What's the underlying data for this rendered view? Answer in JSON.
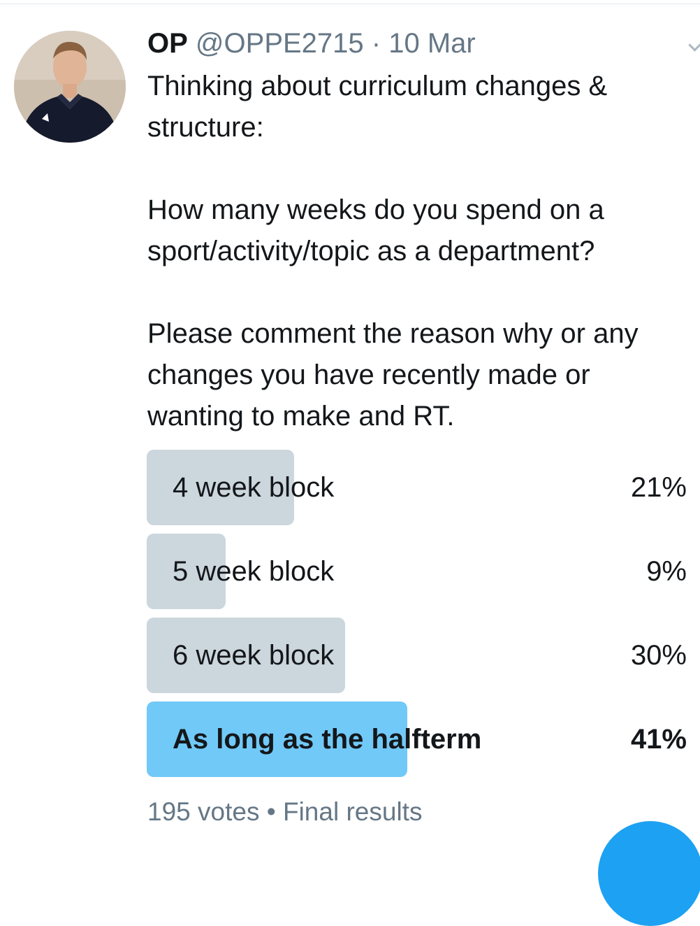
{
  "tweet": {
    "author_name": "OP",
    "handle": "@OPPE2715",
    "separator": "·",
    "date": "10 Mar",
    "text": "Thinking about curriculum changes &\nstructure:\n\nHow many weeks do you spend on a\nsport/activity/topic as a department?\n\nPlease comment the reason why or any\nchanges you have recently made or\nwanting to make and RT."
  },
  "poll": {
    "options": [
      {
        "label": "4 week block",
        "percent_text": "21%",
        "percent": 21
      },
      {
        "label": "5 week block",
        "percent_text": "9%",
        "percent": 9
      },
      {
        "label": "6 week block",
        "percent_text": "30%",
        "percent": 30
      },
      {
        "label": "As long as the halfterm",
        "percent_text": "41%",
        "percent": 41,
        "winner": true
      }
    ],
    "votes": "195 votes",
    "dot": "•",
    "status": "Final results"
  },
  "colors": {
    "poll_bar": "#ccd6dd",
    "poll_bar_winner": "#71c9f8",
    "secondary_text": "#657786",
    "accent": "#1da1f2"
  },
  "icons": {
    "avatar": "profile-photo",
    "caret": "chevron-down-icon",
    "fab": "compose-tweet-icon"
  }
}
